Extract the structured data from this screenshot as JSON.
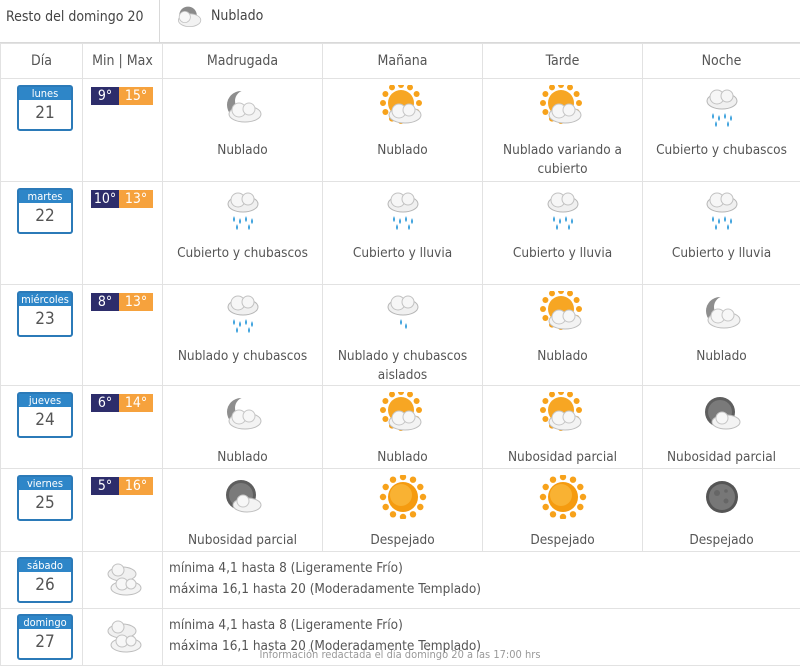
{
  "header": {
    "rest_label": "Resto del domingo 20",
    "now_condition": "Nublado",
    "now_icon": "cloudy-icon"
  },
  "columns": {
    "day": "Día",
    "minmax": "Min | Max",
    "madrugada": "Madrugada",
    "manana": "Mañana",
    "tarde": "Tarde",
    "noche": "Noche"
  },
  "days": [
    {
      "name": "lunes",
      "num": "21",
      "min": "9°",
      "max": "15°",
      "periods": [
        {
          "icon": "moon-cloud-icon",
          "label": "Nublado"
        },
        {
          "icon": "sun-cloud-icon",
          "label": "Nublado"
        },
        {
          "icon": "sun-cloud-icon",
          "label": "Nublado variando a cubierto"
        },
        {
          "icon": "cloud-rain-icon",
          "label": "Cubierto y chubascos"
        }
      ]
    },
    {
      "name": "martes",
      "num": "22",
      "min": "10°",
      "max": "13°",
      "periods": [
        {
          "icon": "cloud-rain-icon",
          "label": "Cubierto y chubascos"
        },
        {
          "icon": "cloud-rain-icon",
          "label": "Cubierto y lluvia"
        },
        {
          "icon": "cloud-rain-icon",
          "label": "Cubierto y lluvia"
        },
        {
          "icon": "cloud-rain-icon",
          "label": "Cubierto y lluvia"
        }
      ]
    },
    {
      "name": "miércoles",
      "num": "23",
      "min": "8°",
      "max": "13°",
      "periods": [
        {
          "icon": "cloud-rain-icon",
          "label": "Nublado y chubascos"
        },
        {
          "icon": "cloud-light-rain-icon",
          "label": "Nublado y chubascos aislados"
        },
        {
          "icon": "sun-cloud-icon",
          "label": "Nublado"
        },
        {
          "icon": "moon-cloud-icon",
          "label": "Nublado"
        }
      ]
    },
    {
      "name": "jueves",
      "num": "24",
      "min": "6°",
      "max": "14°",
      "periods": [
        {
          "icon": "moon-cloud-icon",
          "label": "Nublado"
        },
        {
          "icon": "sun-cloud-icon",
          "label": "Nublado"
        },
        {
          "icon": "sun-cloud-icon",
          "label": "Nubosidad parcial"
        },
        {
          "icon": "moon-cloud-dark-icon",
          "label": "Nubosidad parcial"
        }
      ]
    },
    {
      "name": "viernes",
      "num": "25",
      "min": "5°",
      "max": "16°",
      "periods": [
        {
          "icon": "moon-cloud-dark-icon",
          "label": "Nubosidad parcial"
        },
        {
          "icon": "sun-icon",
          "label": "Despejado"
        },
        {
          "icon": "sun-icon",
          "label": "Despejado"
        },
        {
          "icon": "moon-icon",
          "label": "Despejado"
        }
      ]
    }
  ],
  "extended": [
    {
      "name": "sábado",
      "num": "26",
      "icon": "clouds-icon",
      "line1": "mínima 4,1 hasta 8 (Ligeramente Frío)",
      "line2": "máxima 16,1 hasta 20 (Moderadamente Templado)"
    },
    {
      "name": "domingo",
      "num": "27",
      "icon": "clouds-icon",
      "line1": "mínima 4,1 hasta 8 (Ligeramente Frío)",
      "line2": "máxima 16,1 hasta 20 (Moderadamente Templado)"
    }
  ],
  "footer": "Información redactada el día domingo 20 a las 17:00 hrs",
  "colors": {
    "min_bg": "#2d2d6b",
    "max_bg": "#f6a23d",
    "calendar_blue": "#2e86c8"
  }
}
